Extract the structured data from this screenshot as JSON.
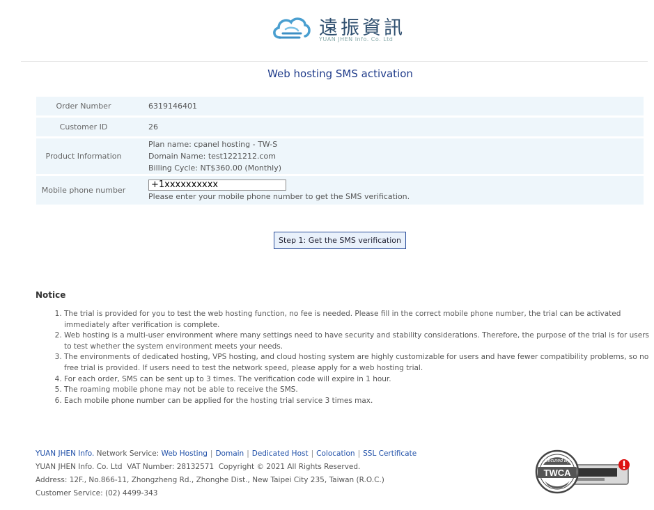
{
  "header": {
    "logo_cn": "遠振資訊",
    "logo_en": "YUAN JHEN Info. Co. Ltd"
  },
  "page_title": "Web hosting SMS activation",
  "form": {
    "order_number_label": "Order Number",
    "order_number_value": "6319146401",
    "customer_id_label": "Customer ID",
    "customer_id_value": "26",
    "product_label": "Product Information",
    "product_lines": [
      "Plan name: cpanel hosting - TW-S",
      "Domain Name: test1221212.com",
      "Billing Cycle: NT$360.00 (Monthly)"
    ],
    "mobile_label": "Mobile phone number",
    "mobile_value": "+1xxxxxxxxxx",
    "mobile_hint": "Please enter your mobile phone number to get the SMS verification."
  },
  "sms_button_label": "Step 1: Get the SMS verification",
  "notice": {
    "title": "Notice",
    "items": [
      "The trial is provided for you to test the web hosting function, no fee is needed. Please fill in the correct mobile phone number, the trial can be activated immediately after verification is complete.",
      "Web hosting is a multi-user environment where many settings need to have security and stability considerations. Therefore, the purpose of the trial is for users to test whether the system environment meets your needs.",
      "The environments of dedicated hosting, VPS hosting, and cloud hosting system are highly customizable for users and have fewer compatibility problems, so no free trial is provided. If users need to test the network speed, please apply for a web hosting trial.",
      "For each order, SMS can be sent up to 3 times. The verification code will expire in 1 hour.",
      "The roaming mobile phone may not be able to receive the SMS.",
      "Each mobile phone number can be applied for the hosting trial service 3 times max."
    ]
  },
  "footer": {
    "company_link": "YUAN JHEN Info.",
    "network_service_text": "Network Service:",
    "links": [
      "Web Hosting",
      "Domain",
      "Dedicated Host",
      "Colocation",
      "SSL Certificate"
    ],
    "line2": "YUAN JHEN Info. Co. Ltd  VAT Number: 28132571  Copyright © 2021 All Rights Reserved.",
    "line3": "Address: 12F., No.866-11, Zhongzheng Rd., Zhonghe Dist., New Taipei City 235, Taiwan (R.O.C.)",
    "line4": "Customer Service: (02) 4499-343"
  },
  "badge": {
    "text_top": "Secured By",
    "text_main": "TWCA"
  },
  "colors": {
    "title_blue": "#1f3b8a",
    "link_blue": "#1f4fa8",
    "row_bg": "#eef6fb",
    "button_border": "#2b4d9a",
    "badge_red": "#d11"
  }
}
